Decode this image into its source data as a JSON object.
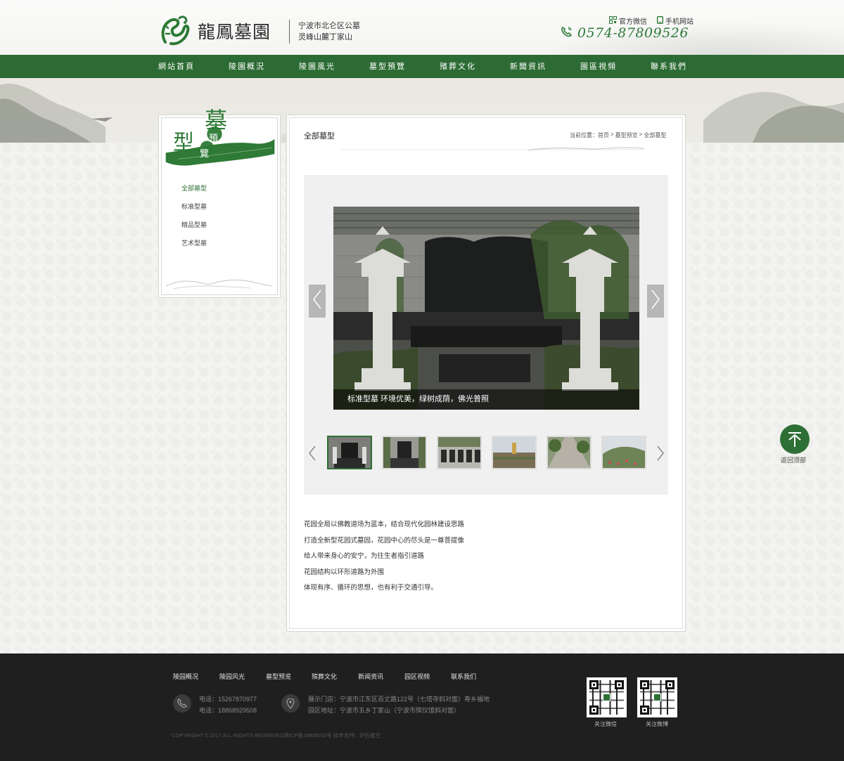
{
  "header": {
    "logo_text": "龍鳳墓園",
    "slogan_line1": "宁波市北仑区公墓",
    "slogan_line2": "灵峰山麓丁家山",
    "wechat_label": "官方微信",
    "mobile_label": "手机网站",
    "phone": "0574-87809526",
    "accent_color": "#2c6b33"
  },
  "nav": {
    "items": [
      "網站首頁",
      "陵園概況",
      "陵園風光",
      "墓型預覽",
      "殯葬文化",
      "新聞資訊",
      "園區視頻",
      "聯系我們"
    ]
  },
  "sidebar": {
    "title_big1": "墓",
    "title_big2": "型",
    "title_small1": "預",
    "title_small2": "覽",
    "items": [
      {
        "label": "全部墓型",
        "active": true
      },
      {
        "label": "标准型墓",
        "active": false
      },
      {
        "label": "精品型墓",
        "active": false
      },
      {
        "label": "艺术型墓",
        "active": false
      }
    ]
  },
  "content": {
    "title": "全部墓型",
    "breadcrumb": [
      "当前位置：首页",
      ">",
      "墓型预览",
      ">",
      "全部墓型"
    ],
    "caption": "标准型墓   环境优美，绿树成荫，佛光普照",
    "thumb_count": 6,
    "description": [
      "花园全局以佛教道场为蓝本，结合现代化园林建设思路",
      "打造全新型花园式墓园，花园中心的尽头是一尊菩提像",
      "给人带来身心的安宁，为往生者指引道路",
      "花园结构以环形道路为外围",
      "体现有序、循环的思想，也有利于交通引导。"
    ]
  },
  "backtop_label": "返回顶部",
  "footer": {
    "nav": [
      "陵园概况",
      "陵园风光",
      "墓型预览",
      "殡葬文化",
      "新闻资讯",
      "园区视频",
      "联系我们"
    ],
    "phone_line1": "电话：15267870977",
    "phone_line2": "电话：18868929508",
    "address_line1": "展示门店：宁波市江东区百丈路122号（七塔寺斜对面）寿乡福地",
    "address_line2": "园区地址：宁波市五乡丁家山（宁波市殡仪馆斜对面）",
    "copyright": "COPYRIGHT © 2017  ALL RIGHTS RESERVED浙ICP备18806033号     技术支持：炉石星空",
    "qr1_label": "关注微信",
    "qr2_label": "关注微博"
  }
}
